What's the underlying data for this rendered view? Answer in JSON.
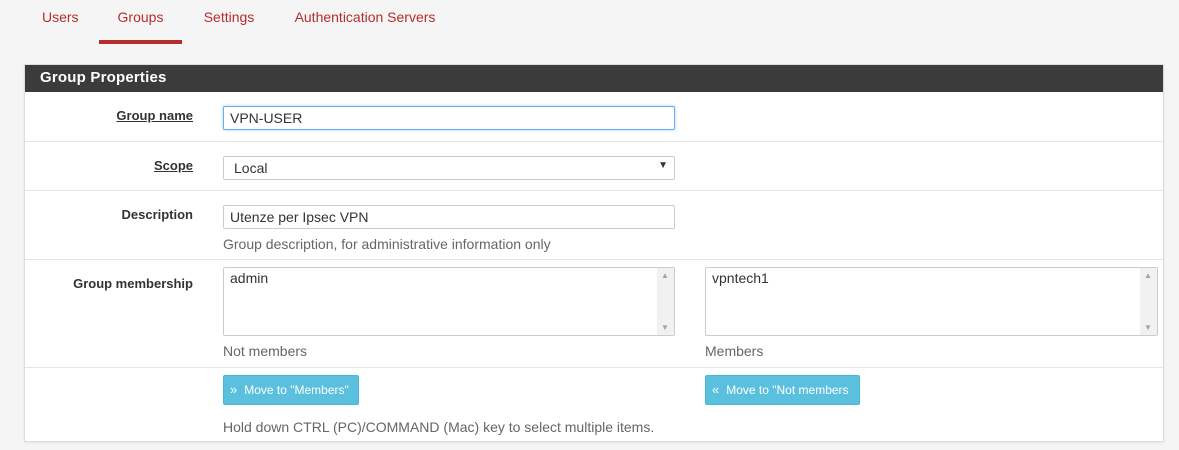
{
  "tabs": [
    {
      "label": "Users"
    },
    {
      "label": "Groups",
      "active": true
    },
    {
      "label": "Settings"
    },
    {
      "label": "Authentication Servers"
    }
  ],
  "panel": {
    "title": "Group Properties"
  },
  "form": {
    "group_name": {
      "label": "Group name",
      "value": "VPN-USER"
    },
    "scope": {
      "label": "Scope",
      "value": "Local"
    },
    "description": {
      "label": "Description",
      "value": "Utenze per Ipsec VPN",
      "help": "Group description, for administrative information only"
    },
    "membership": {
      "label": "Group membership",
      "not_members": {
        "items": [
          "admin"
        ],
        "caption": "Not members"
      },
      "members": {
        "items": [
          "vpntech1"
        ],
        "caption": "Members"
      },
      "move_to_members_label": "Move to \"Members\"",
      "move_to_not_members_label": "Move to \"Not members",
      "hint": "Hold down CTRL (PC)/COMMAND (Mac) key to select multiple items."
    }
  },
  "icons": {
    "move_to_members": "double-chevron-right-icon",
    "move_to_not_members": "double-chevron-left-icon",
    "select_arrow": "caret-down-icon"
  },
  "colors": {
    "accent": "#b52d2d",
    "panel_heading": "#3b3b3b",
    "button_info": "#5bc0de"
  }
}
